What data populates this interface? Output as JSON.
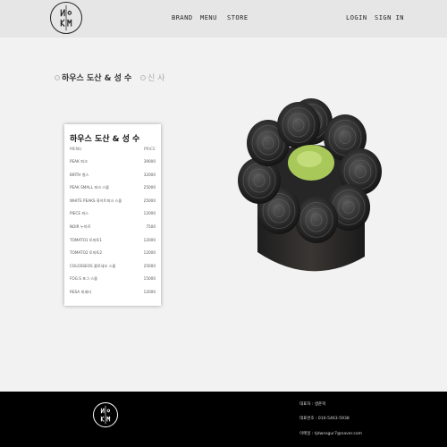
{
  "header": {
    "nav_left": [
      "BRAND",
      "MENU",
      "STORE"
    ],
    "nav_right": [
      "LOGIN",
      "SIGN IN"
    ]
  },
  "tabs": [
    "하우스 도산 & 성 수",
    "신 사"
  ],
  "menu_card": {
    "title": "하우스 도산 & 성 수",
    "col_menu": "MENU",
    "col_price": "PRICE",
    "items": [
      {
        "name": "PEAK 피크",
        "price": "39000"
      },
      {
        "name": "BIRTH 벌스",
        "price": "32000"
      },
      {
        "name": "PEAK SMALL 피크 스몰",
        "price": "25000"
      },
      {
        "name": "WHITE PEAKS 화이트피크 스몰",
        "price": "25000"
      },
      {
        "name": "PIECE 피스",
        "price": "12000"
      },
      {
        "name": "NOIR 누아르",
        "price": "7500"
      },
      {
        "name": "TOMATO1 토마토1",
        "price": "12000"
      },
      {
        "name": "TOMATO2 토마토2",
        "price": "12000"
      },
      {
        "name": "COLOSSEOS 콜로세오 스몰",
        "price": "25000"
      },
      {
        "name": "FOG.S 포그 스몰",
        "price": "15000"
      },
      {
        "name": "RESA 피세타",
        "price": "12000"
      }
    ]
  },
  "footer": {
    "lines": [
      "대표자 : 생준혁",
      "대표번호 : 010-5463-5938",
      "이메일 : tjdwnsgur7@naver.com"
    ]
  },
  "colors": {
    "header_bg": "#e6e6e6",
    "page_bg": "#f2f2f2",
    "footer_bg": "#000000",
    "cake_green": "#a8c95a",
    "cake_dark": "#2a2a2a"
  }
}
